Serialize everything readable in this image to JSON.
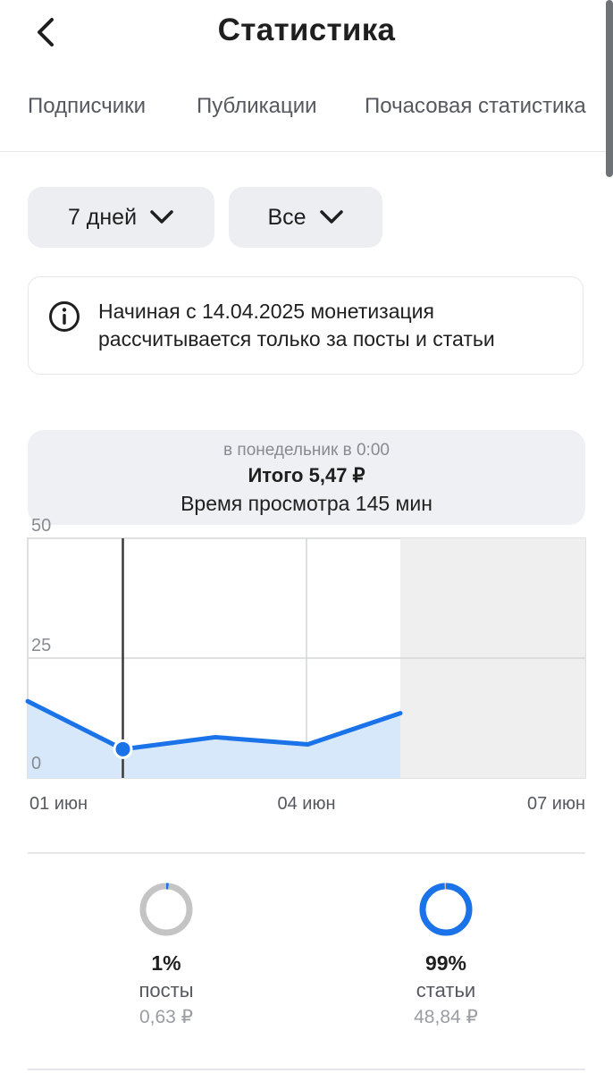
{
  "header": {
    "title": "Статистика"
  },
  "tabs": [
    "Подписчики",
    "Публикации",
    "Почасовая статистика"
  ],
  "filters": {
    "period": "7 дней",
    "type": "Все"
  },
  "notice": {
    "text": "Начиная с 14.04.2025 монетизация рассчитывается только за посты и статьи"
  },
  "tooltip": {
    "when": "в понедельник в 0:00",
    "total": "Итого 5,47 ₽",
    "watch_time": "Время просмотра 145 мин"
  },
  "chart_data": {
    "type": "area",
    "ylim": [
      0,
      50
    ],
    "y_ticks": [
      "50",
      "25",
      "0"
    ],
    "x_tick_labels": [
      "01 июн",
      "04 июн",
      "07 июн"
    ],
    "x": [
      "01 июн",
      "02 июн",
      "03 июн",
      "04 июн",
      "05 июн"
    ],
    "values": [
      16,
      6,
      8.5,
      7,
      13.5
    ],
    "selected_index": 1,
    "future_region_after_index": 4,
    "grid": true,
    "colors": {
      "line": "#1a73e8",
      "fill": "#d7e8fb",
      "future": "#efefef"
    }
  },
  "breakdown": [
    {
      "percent": "1%",
      "label": "посты",
      "amount": "0,63 ₽",
      "fraction": 0.01,
      "color": "#c4c4c4",
      "accent": "#1a73e8"
    },
    {
      "percent": "99%",
      "label": "статьи",
      "amount": "48,84 ₽",
      "fraction": 0.99,
      "color": "#c4c4c4",
      "accent": "#1a73e8"
    }
  ]
}
